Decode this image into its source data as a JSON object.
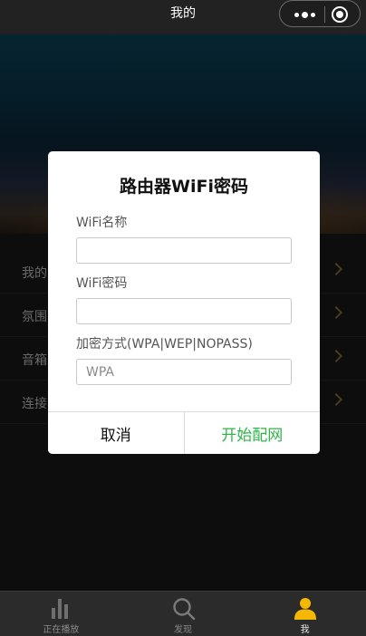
{
  "topbar": {
    "title": "我的"
  },
  "menu": {
    "items": [
      {
        "label": "我的"
      },
      {
        "label": "氛围"
      },
      {
        "label": "音箱"
      },
      {
        "label": "连接"
      }
    ]
  },
  "dialog": {
    "title": "路由器WiFi密码",
    "wifi_name_label": "WiFi名称",
    "wifi_name_value": "",
    "wifi_password_label": "WiFi密码",
    "wifi_password_value": "",
    "encryption_label": "加密方式(WPA|WEP|NOPASS)",
    "encryption_placeholder": "WPA",
    "cancel_label": "取消",
    "confirm_label": "开始配网"
  },
  "tabbar": {
    "tabs": [
      {
        "label": "正在播放",
        "icon": "bar-chart-icon"
      },
      {
        "label": "发现",
        "icon": "search-icon"
      },
      {
        "label": "我",
        "icon": "user-icon"
      }
    ]
  },
  "colors": {
    "accent_green": "#2fb44a",
    "active_tab": "#f5b800"
  }
}
